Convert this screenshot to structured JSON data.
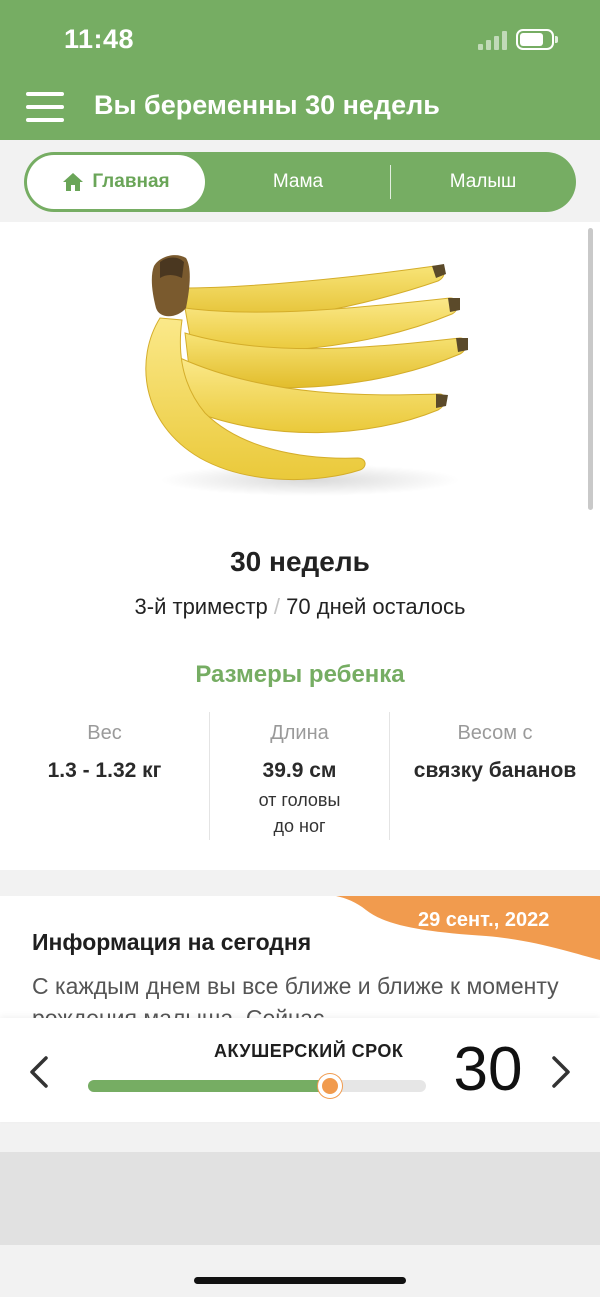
{
  "status_bar": {
    "time": "11:48"
  },
  "header": {
    "title": "Вы беременны 30 недель"
  },
  "tabs": {
    "home": "Главная",
    "mom": "Мама",
    "baby": "Малыш"
  },
  "week_summary": {
    "title": "30 недель",
    "trimester": "3-й триместр",
    "separator": "/",
    "days_left": "70 дней осталось"
  },
  "baby_sizes": {
    "title": "Размеры ребенка",
    "weight": {
      "label": "Вес",
      "value": "1.3 - 1.32 кг"
    },
    "length": {
      "label": "Длина",
      "value": "39.9 см",
      "note_line1": "от головы",
      "note_line2": "до ног"
    },
    "comparison": {
      "label": "Весом с",
      "value": "связку бананов"
    }
  },
  "today_info": {
    "date": "29 сент., 2022",
    "title": "Информация на сегодня",
    "text": "С каждым днем вы все ближе и ближе к моменту рождения малыша. Сейчас"
  },
  "term_selector": {
    "label": "АКУШЕРСКИЙ СРОК",
    "week": "30",
    "progress_fraction": 0.715
  },
  "colors": {
    "brand_green": "#76ad63",
    "accent_orange": "#f19b4e"
  },
  "icons": {
    "menu": "hamburger-icon",
    "home": "home-icon",
    "prev": "chevron-left-icon",
    "next": "chevron-right-icon"
  }
}
